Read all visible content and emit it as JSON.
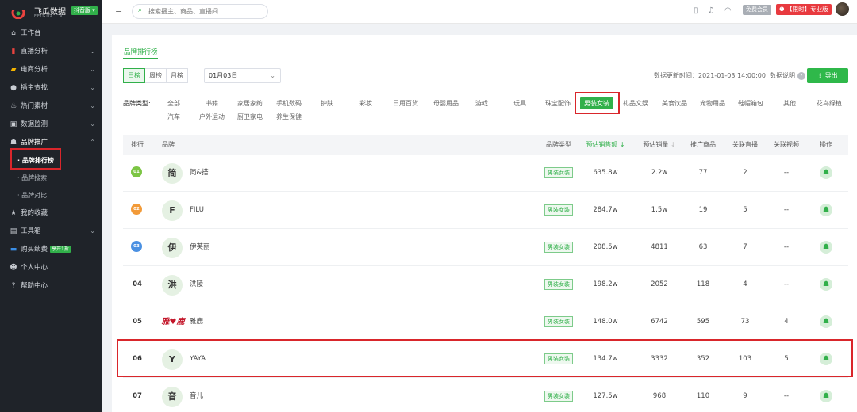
{
  "app": {
    "logo_title": "飞瓜数据",
    "logo_sub": "FEIGUA.CN",
    "edition_badge": "抖音版",
    "brand_color": "#31b04a"
  },
  "sidebar": {
    "items": [
      {
        "label": "工作台",
        "icon": "home-icon"
      },
      {
        "label": "直播分析",
        "icon": "chart-bars-icon"
      },
      {
        "label": "电商分析",
        "icon": "shopping-bag-icon"
      },
      {
        "label": "播主查找",
        "icon": "search-icon"
      },
      {
        "label": "热门素材",
        "icon": "fire-icon"
      },
      {
        "label": "数据监测",
        "icon": "monitor-icon"
      },
      {
        "label": "品牌推广",
        "icon": "brand-icon"
      },
      {
        "label": "我的收藏",
        "icon": "star-icon"
      },
      {
        "label": "工具箱",
        "icon": "toolbox-icon"
      },
      {
        "label": "购买续费",
        "icon": "card-icon",
        "tag": "享开1折"
      },
      {
        "label": "个人中心",
        "icon": "user-icon"
      },
      {
        "label": "帮助中心",
        "icon": "help-icon"
      }
    ],
    "brand_sub": [
      "品牌排行榜",
      "品牌搜索",
      "品牌对比"
    ]
  },
  "topbar": {
    "search_placeholder": "搜索播主、商品、直播间",
    "member_label": "免费会员",
    "promo_label": "【限时】专业版"
  },
  "page": {
    "tab_label": "品牌排行榜",
    "periods": [
      "日榜",
      "周榜",
      "月榜"
    ],
    "selected_period": "日榜",
    "date_value": "01月03日",
    "update_time": "数据更新时间：2021-01-03 14:00:00",
    "data_desc": "数据说明",
    "export_label": "导出"
  },
  "categories": {
    "label": "品牌类型:",
    "row1": [
      "全部",
      "书籍",
      "家居家纺",
      "手机数码",
      "护肤",
      "彩妆",
      "日用百货",
      "母婴用品",
      "游戏",
      "玩具",
      "珠宝配饰",
      "男装女装",
      "礼品文娱",
      "美食饮品",
      "宠物用品",
      "鞋帽箱包",
      "其他",
      "花鸟绿植"
    ],
    "row2": [
      "汽车",
      "户外运动",
      "厨卫家电",
      "养生保健"
    ],
    "selected": "男装女装"
  },
  "table": {
    "headers": [
      "排行",
      "品牌",
      "品牌类型",
      "预估销售额",
      "预估销量",
      "推广商品",
      "关联直播",
      "关联视频",
      "操作"
    ],
    "rows": [
      {
        "rank": "01",
        "logo": "简",
        "name": "简&搭",
        "type": "男装女装",
        "sales": "635.8w",
        "volume": "2.2w",
        "products": "77",
        "lives": "2",
        "videos": "--"
      },
      {
        "rank": "02",
        "logo": "F",
        "name": "FILU",
        "type": "男装女装",
        "sales": "284.7w",
        "volume": "1.5w",
        "products": "19",
        "lives": "5",
        "videos": "--"
      },
      {
        "rank": "03",
        "logo": "伊",
        "name": "伊芙丽",
        "type": "男装女装",
        "sales": "208.5w",
        "volume": "4811",
        "products": "63",
        "lives": "7",
        "videos": "--"
      },
      {
        "rank": "04",
        "logo": "洪",
        "name": "洪陵",
        "type": "男装女装",
        "sales": "198.2w",
        "volume": "2052",
        "products": "118",
        "lives": "4",
        "videos": "--"
      },
      {
        "rank": "05",
        "logo": "雅♥鹿",
        "name": "雅鹿",
        "type": "男装女装",
        "sales": "148.0w",
        "volume": "6742",
        "products": "595",
        "lives": "73",
        "videos": "4"
      },
      {
        "rank": "06",
        "logo": "Y",
        "name": "YAYA",
        "type": "男装女装",
        "sales": "134.7w",
        "volume": "3332",
        "products": "352",
        "lives": "103",
        "videos": "5"
      },
      {
        "rank": "07",
        "logo": "音",
        "name": "音儿",
        "type": "男装女装",
        "sales": "127.5w",
        "volume": "968",
        "products": "110",
        "lives": "9",
        "videos": "--"
      }
    ]
  }
}
